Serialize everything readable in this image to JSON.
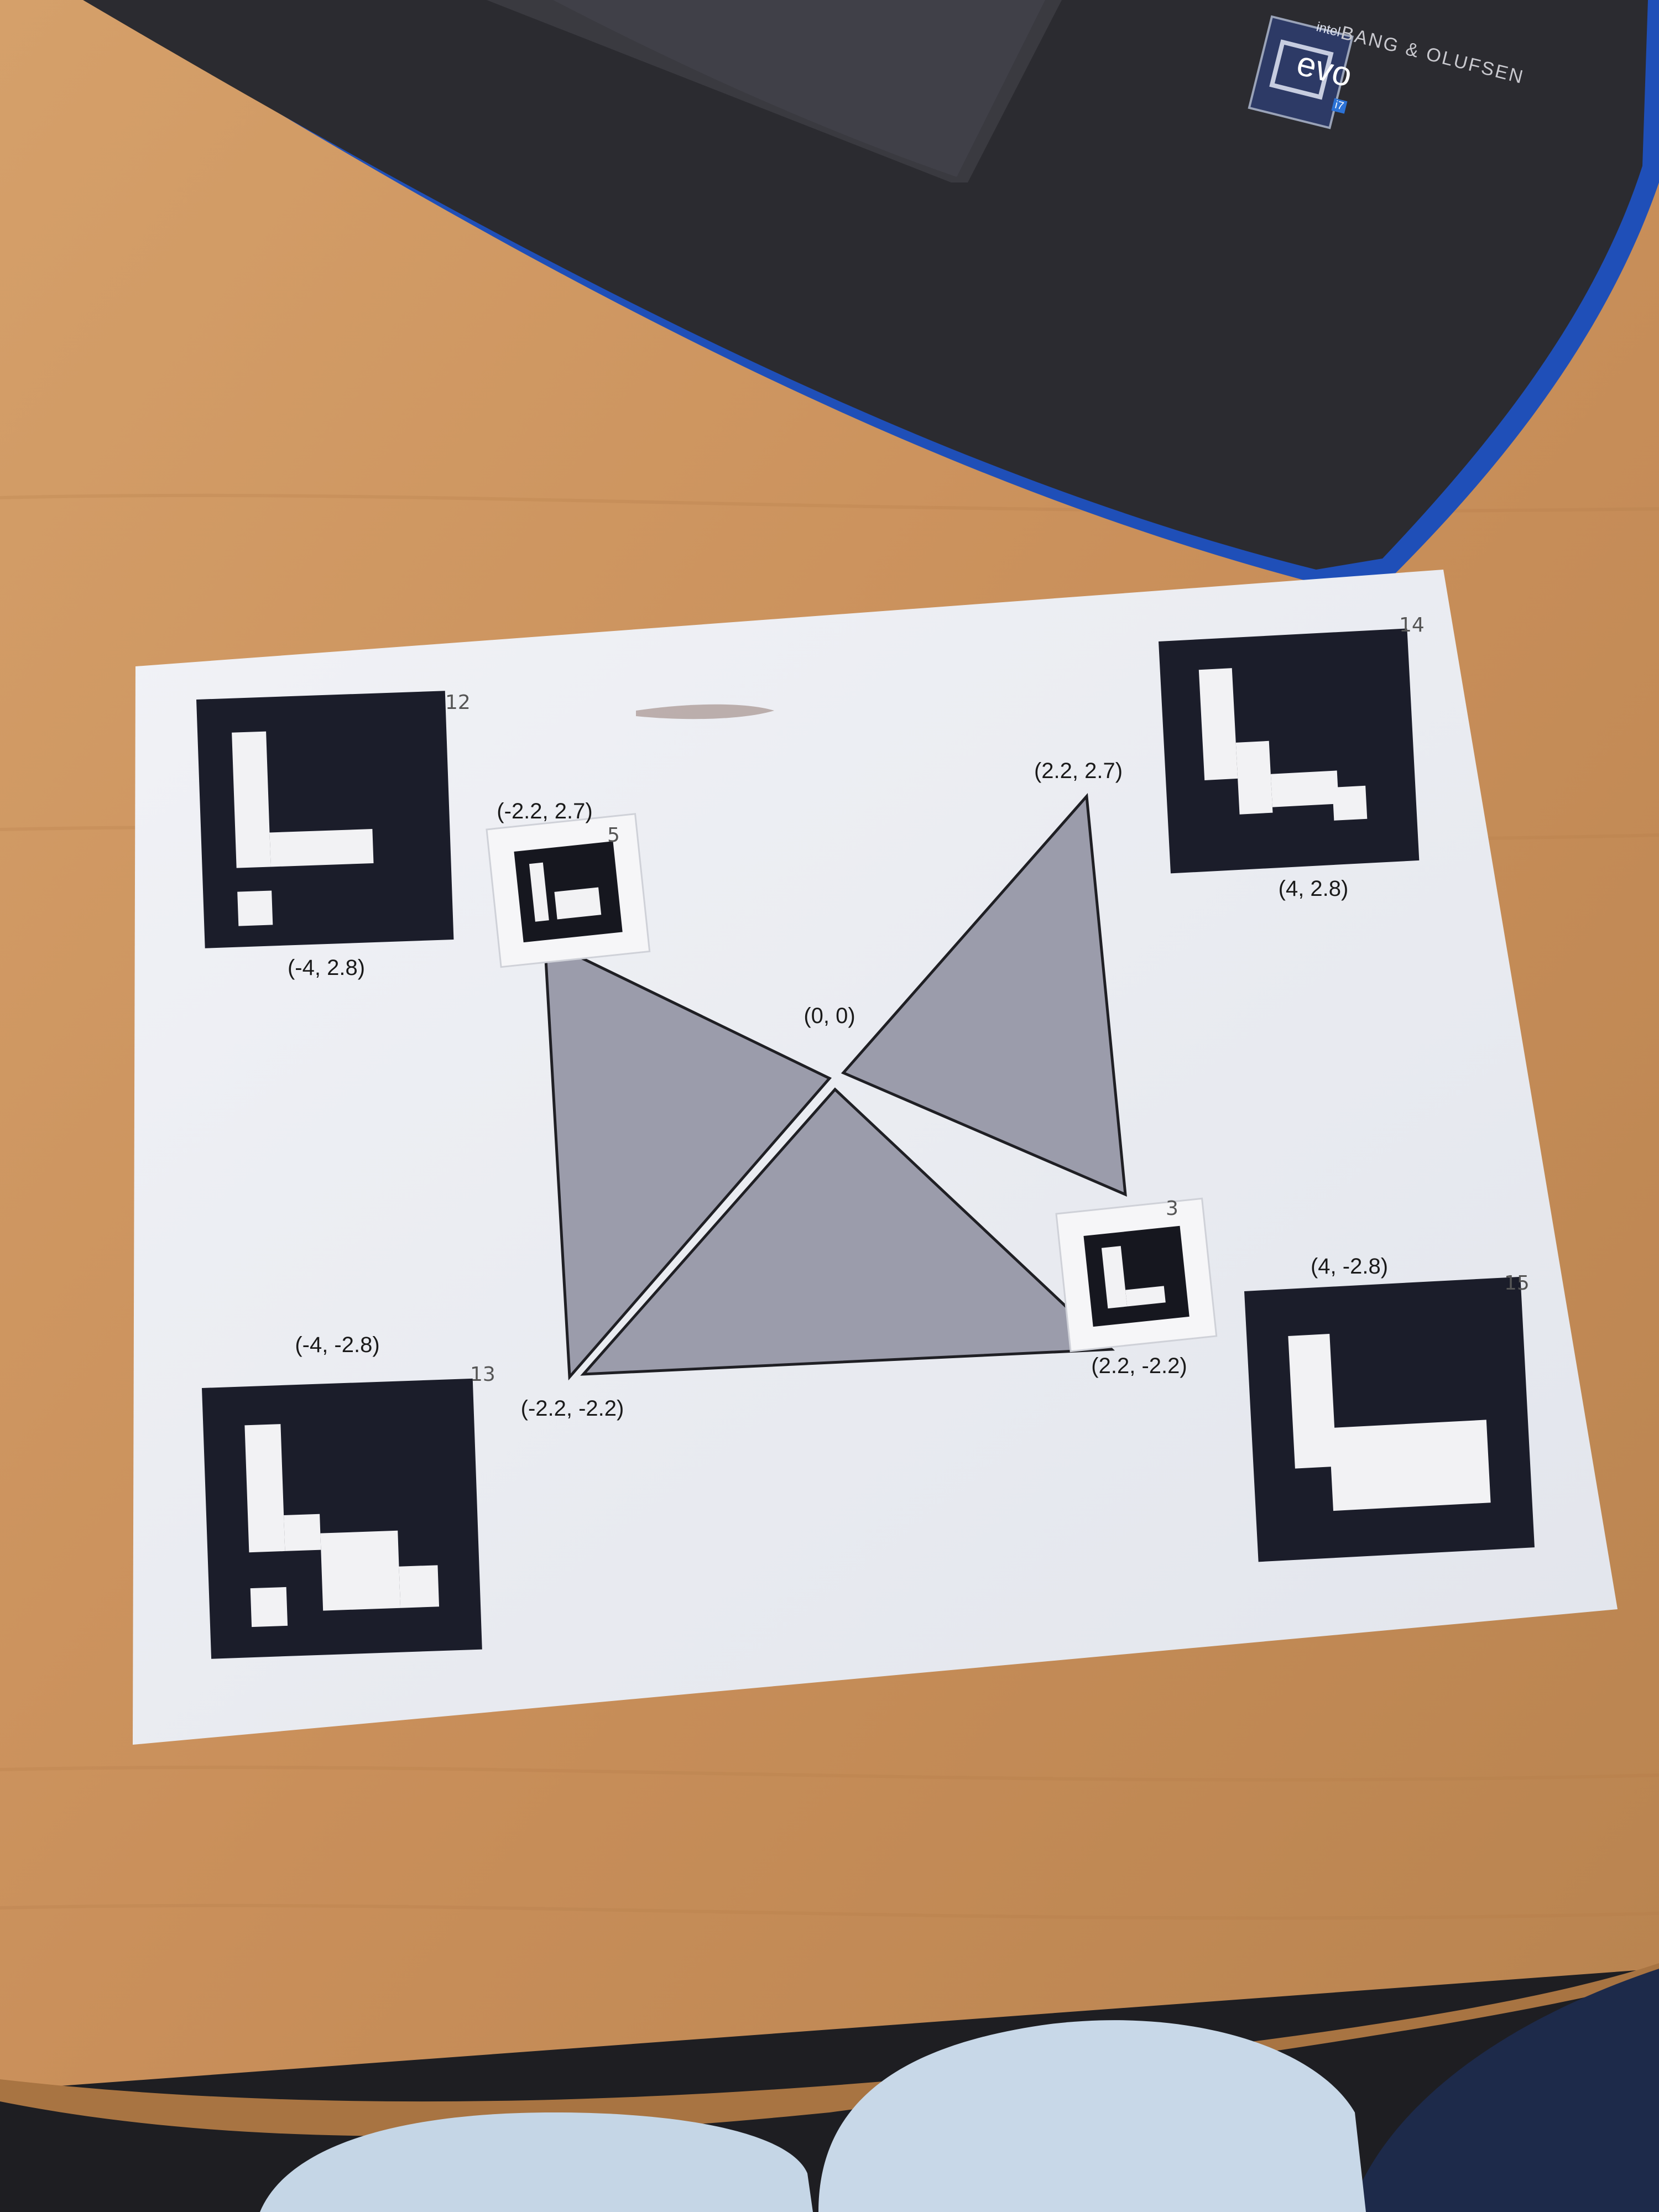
{
  "laptop": {
    "brand": "BANG & OLUFSEN",
    "sticker": {
      "top": "intel",
      "main": "evo",
      "sub": "i7"
    }
  },
  "sheet": {
    "origin_label": "(0, 0)",
    "triangle_vertices": {
      "top_left": "(-2.2, 2.7)",
      "top_right": "(2.2, 2.7)",
      "bottom_left": "(-2.2, -2.2)",
      "bottom_right": "(2.2, -2.2)"
    },
    "corner_markers": [
      {
        "id": "12",
        "coord": "(-4, 2.8)"
      },
      {
        "id": "14",
        "coord": "(4, 2.8)"
      },
      {
        "id": "13",
        "coord": "(-4, -2.8)"
      },
      {
        "id": "15",
        "coord": "(4, -2.8)"
      }
    ],
    "small_markers": [
      {
        "id": "5"
      },
      {
        "id": "3"
      }
    ]
  },
  "colors": {
    "desk": "#c9915e",
    "paper": "#eceef3",
    "triangle_fill": "#9b9cab",
    "marker_black": "#1b1d2a",
    "laptop": "#2b2b30",
    "laptop_edge": "#1f4fb8",
    "pants": "#c5d6e6",
    "chair": "#1d2a4a"
  }
}
